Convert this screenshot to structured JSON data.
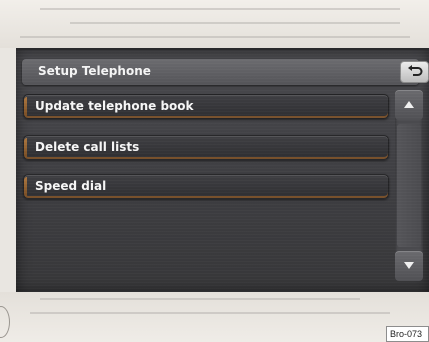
{
  "header": {
    "title": "Setup Telephone",
    "back_icon": "return-arrow-icon"
  },
  "menu": {
    "items": [
      {
        "label": "Update telephone book"
      },
      {
        "label": "Delete call lists"
      },
      {
        "label": "Speed dial"
      }
    ]
  },
  "scrollbar": {
    "up_icon": "arrow-up-icon",
    "down_icon": "arrow-down-icon"
  },
  "figure_label": "Bro-073",
  "colors": {
    "screen_bg": "#3e3e42",
    "header_bg": "#5f5f63",
    "accent": "#c9853e",
    "text": "#f6f6f6"
  }
}
